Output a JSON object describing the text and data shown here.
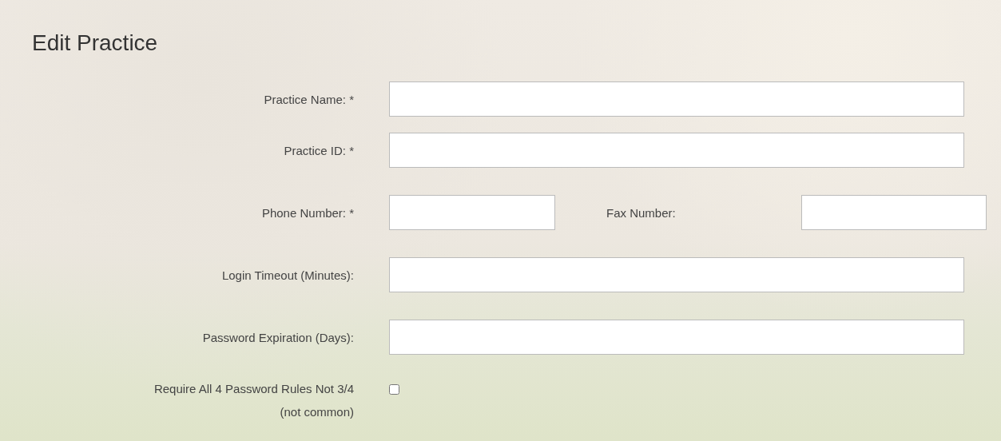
{
  "title": "Edit Practice",
  "rows": [
    {
      "kind": "text",
      "label": "Practice Name: *"
    },
    {
      "kind": "text",
      "label": "Practice ID: *"
    },
    {
      "kind": "pair",
      "label": "Phone Number: *",
      "second_label": "Fax Number:"
    },
    {
      "kind": "text",
      "label": "Login Timeout (Minutes):"
    },
    {
      "kind": "text",
      "label": "Password Expiration (Days):"
    },
    {
      "kind": "checkbox",
      "label": "Require All 4 Password Rules Not 3/4",
      "note": "(not common)",
      "checked": false
    }
  ]
}
